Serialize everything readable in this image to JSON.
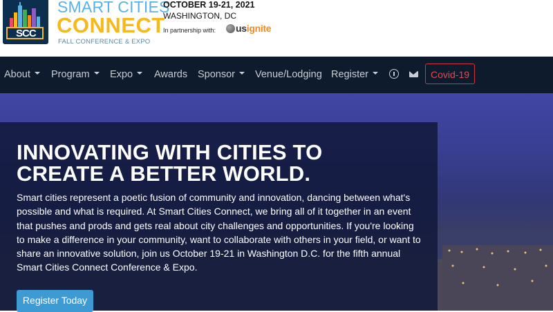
{
  "header": {
    "logo_text": "SCC",
    "brand_line1": "SMART CITIES",
    "brand_line2": "CONNECT",
    "brand_sub": "FALL CONFERENCE & EXPO",
    "event_date": "OCTOBER 19-21, 2021",
    "event_location": "WASHINGTON, DC",
    "partner_label": "In partnership with:",
    "partner_name_a": "us",
    "partner_name_b": "ignite"
  },
  "nav": {
    "items": [
      {
        "label": "About",
        "dropdown": true
      },
      {
        "label": "Program",
        "dropdown": true
      },
      {
        "label": "Expo",
        "dropdown": true
      },
      {
        "label": "Awards",
        "dropdown": false
      },
      {
        "label": "Sponsor",
        "dropdown": true
      },
      {
        "label": "Venue/Lodging",
        "dropdown": false
      },
      {
        "label": "Register",
        "dropdown": true
      }
    ],
    "icons": [
      "info-icon",
      "mail-icon"
    ],
    "covid_label": "Covid-19"
  },
  "hero": {
    "title": "INNOVATING WITH CITIES TO CREATE A BETTER WORLD.",
    "body": "Smart cities represent a poetic fusion of community and innovation, dancing between what's possible and what is required. At Smart Cities Connect, we bring all of it together in an event that pushes and prods and gets real about city challenges and opportunities. If you're looking to make a difference in your community, want to collaborate with others in your field, or want to share an innovative solution, join us October 19-21 in Washington D.C. for the fifth annual Smart Cities Connect Conference & Expo.",
    "cta_label": "Register Today"
  },
  "colors": {
    "nav_bg": "#0e1b2c",
    "brand_blue": "#5ab2e4",
    "brand_yellow": "#f7b81c",
    "covid_red": "#d0343e",
    "cta_blue": "#3d9ad3"
  }
}
